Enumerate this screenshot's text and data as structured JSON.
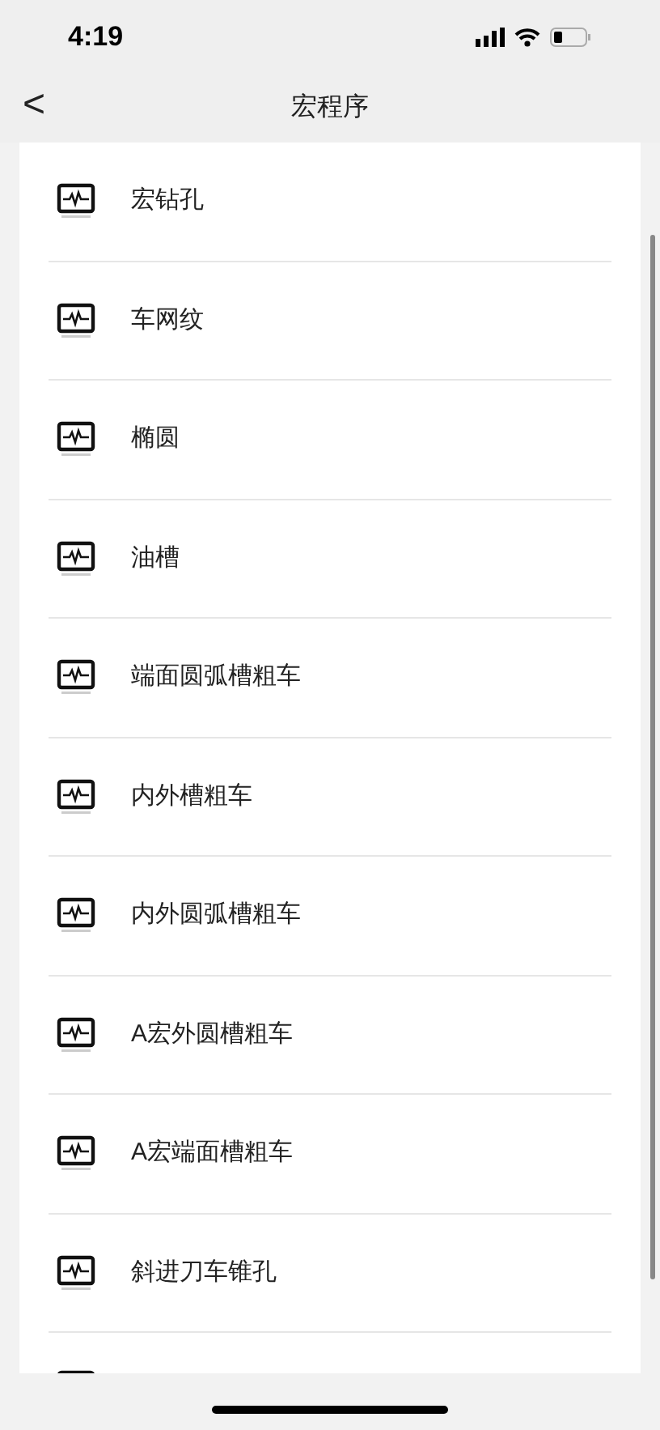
{
  "status_bar": {
    "time": "4:19"
  },
  "nav": {
    "back": "<",
    "title": "宏程序"
  },
  "items": [
    {
      "label": "宏钻孔"
    },
    {
      "label": "车网纹"
    },
    {
      "label": "椭圆"
    },
    {
      "label": "油槽"
    },
    {
      "label": "端面圆弧槽粗车"
    },
    {
      "label": "内外槽粗车"
    },
    {
      "label": "内外圆弧槽粗车"
    },
    {
      "label": "A宏外圆槽粗车"
    },
    {
      "label": "A宏端面槽粗车"
    },
    {
      "label": "斜进刀车锥孔"
    }
  ]
}
